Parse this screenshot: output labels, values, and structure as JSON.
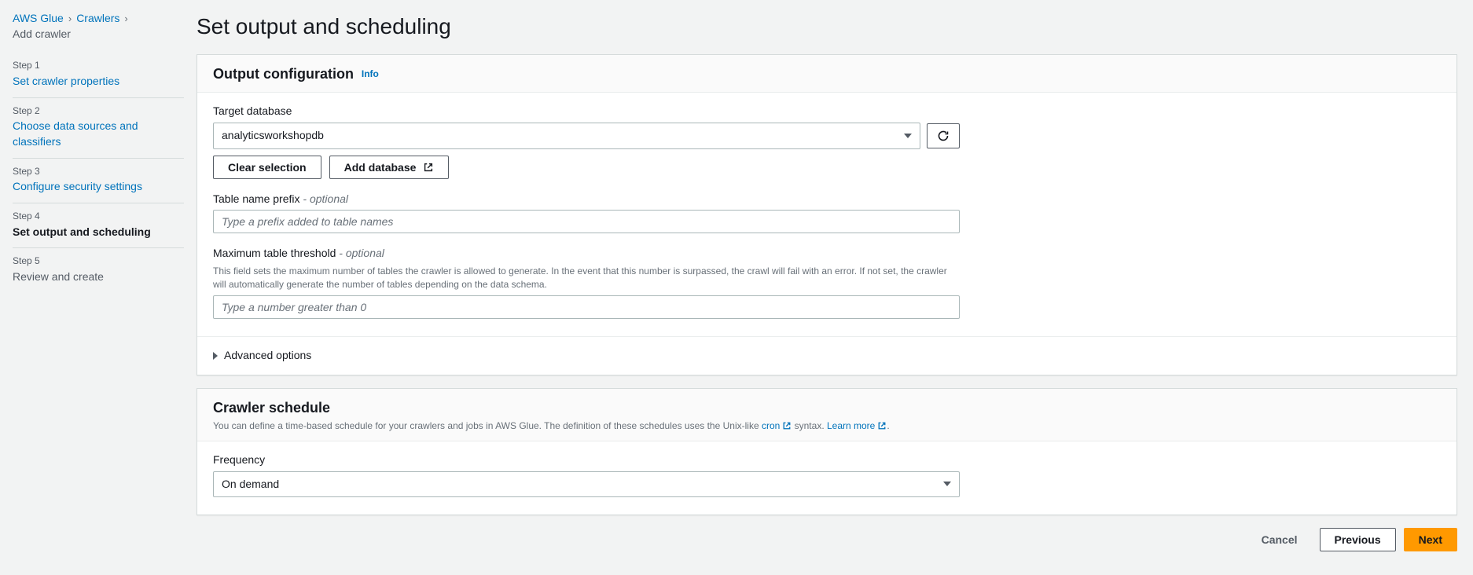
{
  "breadcrumb": {
    "items": [
      "AWS Glue",
      "Crawlers"
    ],
    "current": "Add crawler"
  },
  "steps": {
    "label_prefix": "Step",
    "items": [
      {
        "num": "1",
        "title": "Set crawler properties",
        "state": "link"
      },
      {
        "num": "2",
        "title": "Choose data sources and classifiers",
        "state": "link"
      },
      {
        "num": "3",
        "title": "Configure security settings",
        "state": "link"
      },
      {
        "num": "4",
        "title": "Set output and scheduling",
        "state": "active"
      },
      {
        "num": "5",
        "title": "Review and create",
        "state": "disabled"
      }
    ]
  },
  "page": {
    "title": "Set output and scheduling"
  },
  "output": {
    "panel_title": "Output configuration",
    "info_label": "Info",
    "target_db_label": "Target database",
    "target_db_value": "analyticsworkshopdb",
    "clear_button": "Clear selection",
    "add_db_button": "Add database",
    "prefix_label": "Table name prefix",
    "prefix_optional": "- optional",
    "prefix_placeholder": "Type a prefix added to table names",
    "max_tables_label": "Maximum table threshold",
    "max_tables_optional": "- optional",
    "max_tables_desc": "This field sets the maximum number of tables the crawler is allowed to generate. In the event that this number is surpassed, the crawl will fail with an error. If not set, the crawler will automatically generate the number of tables depending on the data schema.",
    "max_tables_placeholder": "Type a number greater than 0",
    "advanced_label": "Advanced options"
  },
  "schedule": {
    "panel_title": "Crawler schedule",
    "desc_prefix": "You can define a time-based schedule for your crawlers and jobs in AWS Glue. The definition of these schedules uses the Unix-like ",
    "desc_cron": "cron",
    "desc_mid": " syntax. ",
    "desc_learn": "Learn more",
    "desc_suffix": ".",
    "frequency_label": "Frequency",
    "frequency_value": "On demand"
  },
  "footer": {
    "cancel": "Cancel",
    "previous": "Previous",
    "next": "Next"
  }
}
